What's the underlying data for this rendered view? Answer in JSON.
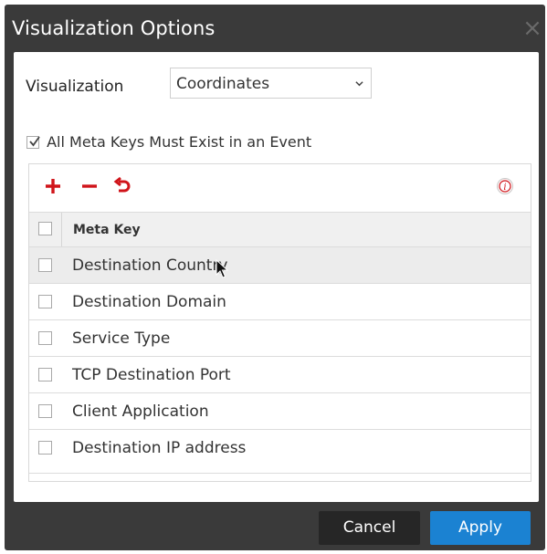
{
  "dialog": {
    "title": "Visualization Options",
    "close_icon": "close-icon"
  },
  "visualization": {
    "label": "Visualization",
    "selected": "Coordinates"
  },
  "all_meta_keys": {
    "label": "All Meta Keys Must Exist in an Event",
    "checked": true
  },
  "toolbar": {
    "add_icon": "plus-icon",
    "remove_icon": "minus-icon",
    "reset_icon": "undo-icon",
    "info_icon": "info-icon"
  },
  "table": {
    "header": "Meta Key",
    "rows": [
      {
        "label": "Destination Country",
        "checked": false
      },
      {
        "label": "Destination Domain",
        "checked": false
      },
      {
        "label": "Service Type",
        "checked": false
      },
      {
        "label": "TCP Destination Port",
        "checked": false
      },
      {
        "label": "Client Application",
        "checked": false
      },
      {
        "label": "Destination IP address",
        "checked": false
      }
    ]
  },
  "footer": {
    "cancel_label": "Cancel",
    "apply_label": "Apply"
  },
  "colors": {
    "dialog_bg": "#3a3a3a",
    "accent": "#1b82d2",
    "toolbar_red": "#d0141a"
  }
}
